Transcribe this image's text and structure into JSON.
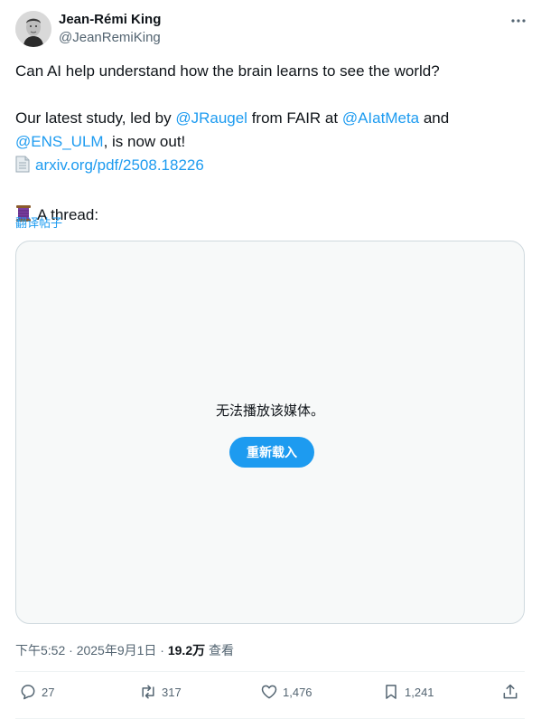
{
  "author": {
    "name": "Jean-Rémi King",
    "handle": "@JeanRemiKing"
  },
  "tweet": {
    "line1": "Can AI help understand how the brain learns to see the world?",
    "line2_a": "Our latest study, led by ",
    "mention1": "@JRaugel",
    "line2_b": " from FAIR at ",
    "mention2": "@AIatMeta",
    "line2_c": " and",
    "mention3": "@ENS_ULM",
    "line3_b": ", is now out!",
    "link": "arxiv.org/pdf/2508.18226",
    "thread": "A thread:",
    "translate": "翻译帖子"
  },
  "media": {
    "message": "无法播放该媒体。",
    "reload": "重新载入"
  },
  "meta": {
    "time": "下午5:52 · 2025年9月1日 · ",
    "views": "19.2万",
    "views_label": " 查看"
  },
  "actions": {
    "reply": "27",
    "retweet": "317",
    "like": "1,476",
    "bookmark": "1,241"
  },
  "colors": {
    "accent": "#1d9bf0",
    "muted": "#536471",
    "text": "#0f1419"
  }
}
